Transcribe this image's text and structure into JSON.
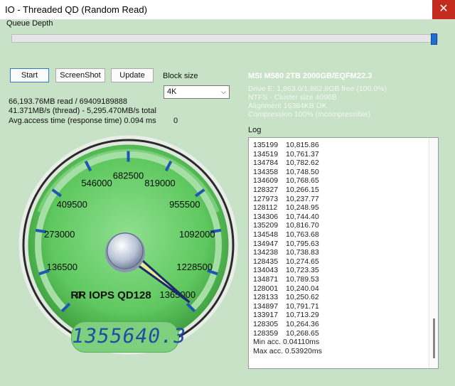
{
  "window": {
    "title": "IO - Threaded QD (Random Read)",
    "close_glyph": "✕"
  },
  "queue_depth": {
    "label": "Queue Depth",
    "level_percent": 100
  },
  "buttons": {
    "start": "Start",
    "screenshot": "ScreenShot",
    "update": "Update"
  },
  "block_size": {
    "label": "Block size",
    "selected": "4K"
  },
  "stats": {
    "line1": "66,193.76MB read / 69409189888",
    "line2": "41.371MB/s (thread) - 5,295.470MB/s total",
    "line3": "Avg.access time (response time) 0.094 ms",
    "line3_value": "0"
  },
  "drive": {
    "name": "MSI M580 2TB 2000GB/EQFM22.3",
    "info": [
      "Drive E: 1,863.0/1,862.8GB free (100.0%)",
      "NTFS - Cluster size 4096B",
      "Alignment 16384KB OK",
      "Compression 100% (Incompressible)"
    ]
  },
  "log": {
    "label": "Log",
    "rows": [
      [
        "135199",
        "10,815.86"
      ],
      [
        "134519",
        "10,761.37"
      ],
      [
        "134784",
        "10,782.62"
      ],
      [
        "134358",
        "10,748.50"
      ],
      [
        "134609",
        "10,768.65"
      ],
      [
        "128327",
        "10,266.15"
      ],
      [
        "127973",
        "10,237.77"
      ],
      [
        "128112",
        "10,248.95"
      ],
      [
        "134306",
        "10,744.40"
      ],
      [
        "135209",
        "10,816.70"
      ],
      [
        "134548",
        "10,763.68"
      ],
      [
        "134947",
        "10,795.63"
      ],
      [
        "134238",
        "10,738.83"
      ],
      [
        "128435",
        "10,274.65"
      ],
      [
        "134043",
        "10,723.35"
      ],
      [
        "134871",
        "10,789.53"
      ],
      [
        "128001",
        "10,240.04"
      ],
      [
        "128133",
        "10,250.62"
      ],
      [
        "134897",
        "10,791.71"
      ],
      [
        "133917",
        "10,713.29"
      ],
      [
        "128305",
        "10,264.36"
      ],
      [
        "128359",
        "10,268.65"
      ]
    ],
    "footer": [
      "Min acc. 0.04110ms",
      "Max acc. 0.53920ms"
    ]
  },
  "gauge": {
    "ticks": [
      "0",
      "136500",
      "273000",
      "409500",
      "546000",
      "682500",
      "819000",
      "955500",
      "1092000",
      "1228500",
      "1365000"
    ],
    "caption": "RR IOPS QD128",
    "readout": "1355640.3",
    "value": 1355640.3,
    "max": 1365000
  },
  "colors": {
    "window_bg": "#c7e2c7",
    "gauge_face": "#5fc85f",
    "gauge_accent": "#1f56b5",
    "close_red": "#c42b1c"
  }
}
